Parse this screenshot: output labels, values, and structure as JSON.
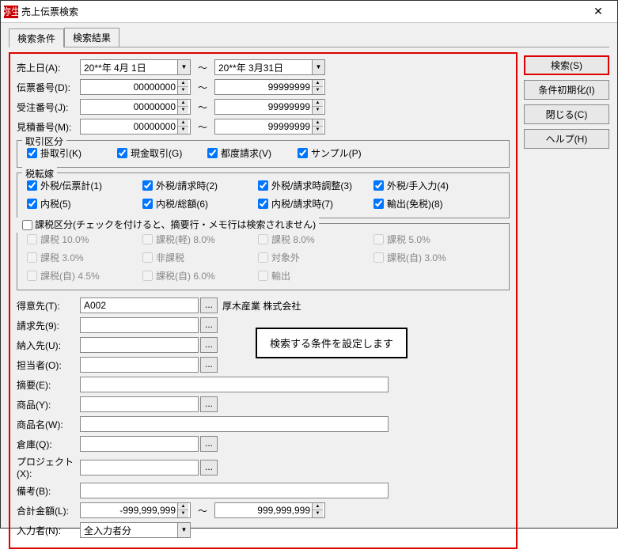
{
  "window": {
    "title": "売上伝票検索"
  },
  "tabs": {
    "t1": "検索条件",
    "t2": "検索結果"
  },
  "buttons": {
    "search": "検索(S)",
    "reset": "条件初期化(I)",
    "close": "閉じる(C)",
    "help": "ヘルプ(H)"
  },
  "labels": {
    "salesDate": "売上日(A):",
    "slipNo": "伝票番号(D):",
    "orderNo": "受注番号(J):",
    "estNo": "見積番号(M):",
    "customer": "得意先(T):",
    "billto": "請求先(9):",
    "delivto": "納入先(U):",
    "person": "担当者(O):",
    "summary": "摘要(E):",
    "product": "商品(Y):",
    "productName": "商品名(W):",
    "warehouse": "倉庫(Q):",
    "project": "プロジェクト(X):",
    "remarks": "備考(B):",
    "total": "合計金額(L):",
    "entrant": "入力者(N):"
  },
  "dates": {
    "from": "20**年 4月 1日",
    "to": "20**年 3月31日"
  },
  "nums": {
    "zero": "00000000",
    "nine": "99999999"
  },
  "totals": {
    "min": "-999,999,999",
    "max": "999,999,999"
  },
  "tilde": "～",
  "grp": {
    "deal": "取引区分",
    "dealItems": {
      "k": "掛取引(K)",
      "g": "現金取引(G)",
      "v": "都度請求(V)",
      "p": "サンプル(P)"
    },
    "tax": "税転嫁",
    "taxItems": {
      "t1": "外税/伝票計(1)",
      "t2": "外税/請求時(2)",
      "t3": "外税/請求時調整(3)",
      "t4": "外税/手入力(4)",
      "t5": "内税(5)",
      "t6": "内税/総額(6)",
      "t7": "内税/請求時(7)",
      "t8": "輸出(免税)(8)"
    },
    "cls": "課税区分(チェックを付けると、摘要行・メモ行は検索されません)",
    "clsItems": {
      "c1": "課税 10.0%",
      "c2": "課税(軽) 8.0%",
      "c3": "課税 8.0%",
      "c4": "課税 5.0%",
      "c5": "課税 3.0%",
      "c6": "非課税",
      "c7": "対象外",
      "c8": "課税(自) 3.0%",
      "c9": "課税(自) 4.5%",
      "c10": "課税(自) 6.0%",
      "c11": "輸出"
    }
  },
  "customer": {
    "code": "A002",
    "name": "厚木産業 株式会社"
  },
  "entrant": "全入力者分",
  "callout": "検索する条件を設定します"
}
